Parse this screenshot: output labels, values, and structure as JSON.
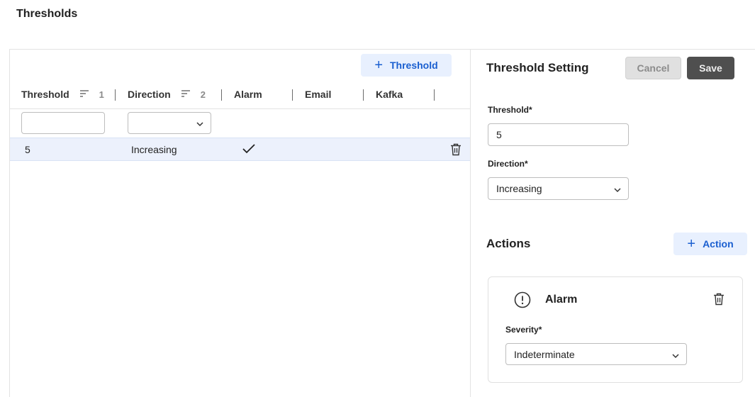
{
  "page": {
    "title": "Thresholds"
  },
  "table": {
    "add_button_label": "Threshold",
    "columns": [
      {
        "label": "Threshold",
        "sort_order": "1"
      },
      {
        "label": "Direction",
        "sort_order": "2"
      },
      {
        "label": "Alarm"
      },
      {
        "label": "Email"
      },
      {
        "label": "Kafka"
      }
    ],
    "filters": {
      "threshold_value": "",
      "direction_value": ""
    },
    "rows": [
      {
        "threshold": "5",
        "direction": "Increasing",
        "alarm": true,
        "email": false,
        "kafka": false
      }
    ]
  },
  "setting": {
    "title": "Threshold Setting",
    "cancel_label": "Cancel",
    "save_label": "Save",
    "threshold_label": "Threshold*",
    "threshold_value": "5",
    "direction_label": "Direction*",
    "direction_value": "Increasing"
  },
  "actions": {
    "title": "Actions",
    "add_button_label": "Action",
    "items": [
      {
        "title": "Alarm",
        "severity_label": "Severity*",
        "severity_value": "Indeterminate"
      }
    ]
  },
  "colors": {
    "accent": "#1a5fd0",
    "accent_bg": "#e8f0fe",
    "selected_row_bg": "#ecf1fc",
    "save_bg": "#4f4f4f",
    "cancel_bg": "#e0e0e0"
  },
  "icons": [
    "plus-icon",
    "sort-icon",
    "chevron-down-icon",
    "check-icon",
    "trash-icon",
    "alert-circle-icon"
  ]
}
